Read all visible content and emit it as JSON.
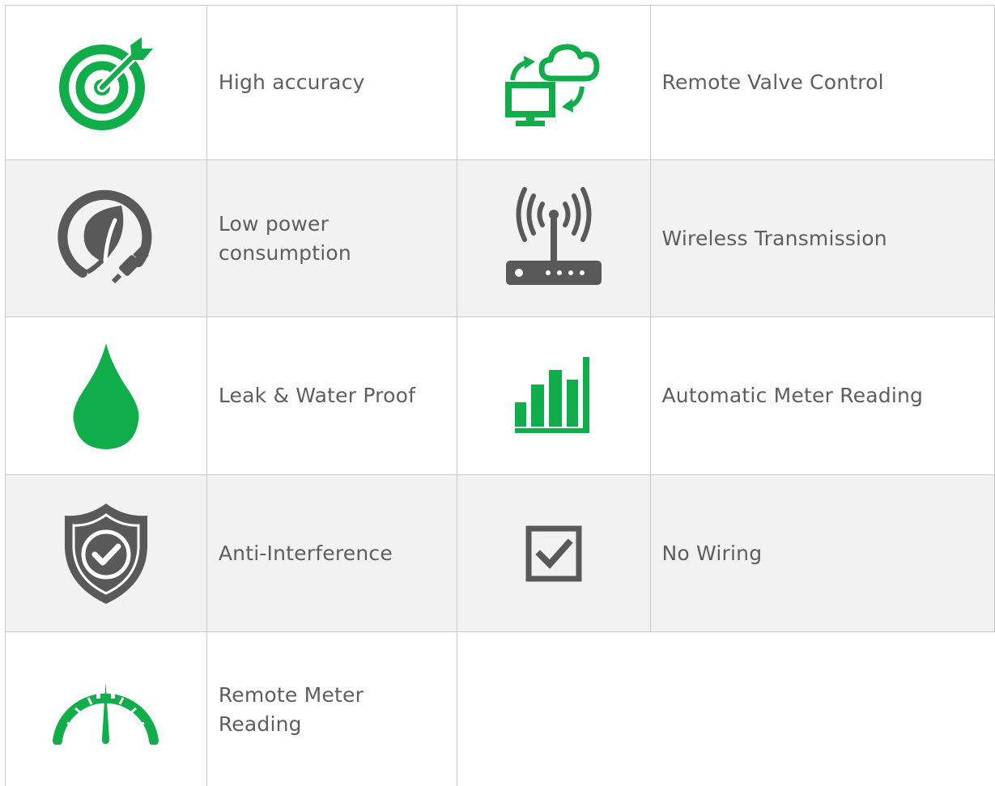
{
  "colors": {
    "green": "#10ad4b",
    "gray": "#595959",
    "border": "#c9c9c9",
    "shade": "#f2f2f2"
  },
  "features": [
    {
      "label": "High accuracy",
      "icon": "target-icon"
    },
    {
      "label": "Remote Valve Control",
      "icon": "cloud-sync-icon"
    },
    {
      "label": "Low power consumption",
      "icon": "eco-plug-icon"
    },
    {
      "label": "Wireless Transmission",
      "icon": "router-icon"
    },
    {
      "label": "Leak & Water Proof",
      "icon": "water-drop-icon"
    },
    {
      "label": "Automatic Meter Reading",
      "icon": "bar-chart-icon"
    },
    {
      "label": "Anti-Interference",
      "icon": "shield-check-icon"
    },
    {
      "label": "No Wiring",
      "icon": "checkbox-icon"
    },
    {
      "label": "Remote Meter Reading",
      "icon": "gauge-icon"
    }
  ]
}
